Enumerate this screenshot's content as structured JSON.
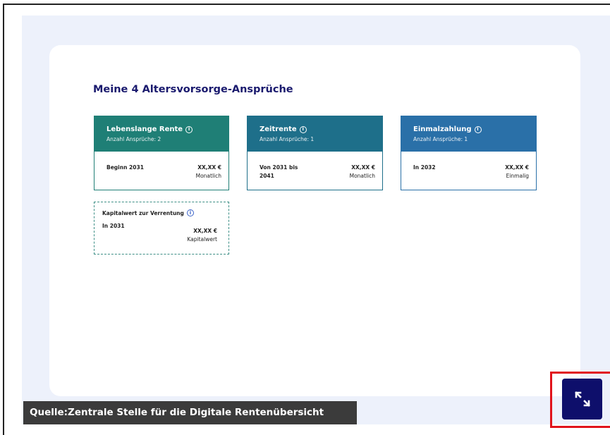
{
  "section": {
    "heading": "Meine 4 Altersvorsorge-Ansprüche"
  },
  "claims": [
    {
      "title": "Lebenslange Rente",
      "count": "Anzahl Ansprüche: 2",
      "date": "Beginn 2031",
      "amount": "XX,XX €",
      "period": "Monatlich",
      "color": "#1f7f76"
    },
    {
      "title": "Zeitrente",
      "count": "Anzahl Ansprüche: 1",
      "date_line1": "Von 2031 bis",
      "date_line2": "2041",
      "amount": "XX,XX €",
      "period": "Monatlich",
      "color": "#1e6f8a"
    },
    {
      "title": "Einmalzahlung",
      "count": "Anzahl Ansprüche: 1",
      "date": "In 2032",
      "amount": "XX,XX €",
      "period": "Einmalig",
      "color": "#2a70a8"
    }
  ],
  "capital": {
    "title": "Kapitalwert zur Verrentung",
    "date": "In 2031",
    "amount": "XX,XX €",
    "label": "Kapitalwert"
  },
  "caption": "Quelle:Zentrale Stelle für die Digitale Rentenübersicht",
  "icons": {
    "info": "i",
    "expand": "expand-icon"
  },
  "colors": {
    "heading": "#1a1a6e",
    "expand_button": "#0e0f6b",
    "highlight": "#e1131b"
  }
}
